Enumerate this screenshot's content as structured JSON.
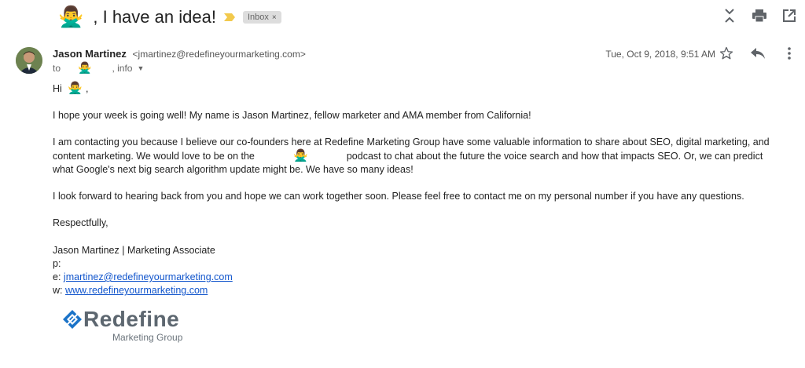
{
  "subject": {
    "emoji": "🙅‍♂️",
    "text": ", I have an idea!",
    "label": "Inbox",
    "label_close": "×"
  },
  "top_icons": [
    "collapse-all-icon",
    "print-icon",
    "open-new-window-icon"
  ],
  "message": {
    "sender_name": "Jason Martinez",
    "sender_email": "<jmartinez@redefineyourmarketing.com>",
    "to_prefix": "to",
    "to_emoji": "🙅‍♂️",
    "to_suffix": ", info",
    "date": "Tue, Oct 9, 2018, 9:51 AM",
    "actions": [
      "star-icon",
      "reply-icon",
      "more-vert-icon"
    ]
  },
  "body": {
    "greeting_prefix": "Hi",
    "greeting_emoji": "🙅‍♂️",
    "greeting_suffix": ",",
    "p1": "I hope your week is going well! My name is Jason Martinez, fellow marketer and AMA member from California!",
    "p2_a": "I am contacting you because I believe our co-founders here at Redefine Marketing Group have some valuable information to share about SEO, digital marketing, and content marketing. We would love to be on the",
    "p2_emoji": "🙅‍♂️",
    "p2_b": "podcast to chat about the future the voice search and how that impacts SEO. Or, we can predict what Google's next big search algorithm update might be. We have so many ideas!",
    "p3": "I look forward to hearing back from you and hope we can work together soon. Please feel free to contact me on my personal number if you have any questions.",
    "closing": "Respectfully,"
  },
  "signature": {
    "line1": "Jason Martinez | Marketing Associate",
    "phone_label": "p:",
    "email_label": "e:",
    "email": "jmartinez@redefineyourmarketing.com",
    "web_label": "w:",
    "web": "www.redefineyourmarketing.com"
  },
  "logo": {
    "word": "Redefine",
    "sub": "Marketing Group"
  },
  "colors": {
    "link": "#1155cc",
    "important_marker": "#f2c94c",
    "logo_blue": "#1a73c8",
    "logo_gray": "#5d6770"
  }
}
